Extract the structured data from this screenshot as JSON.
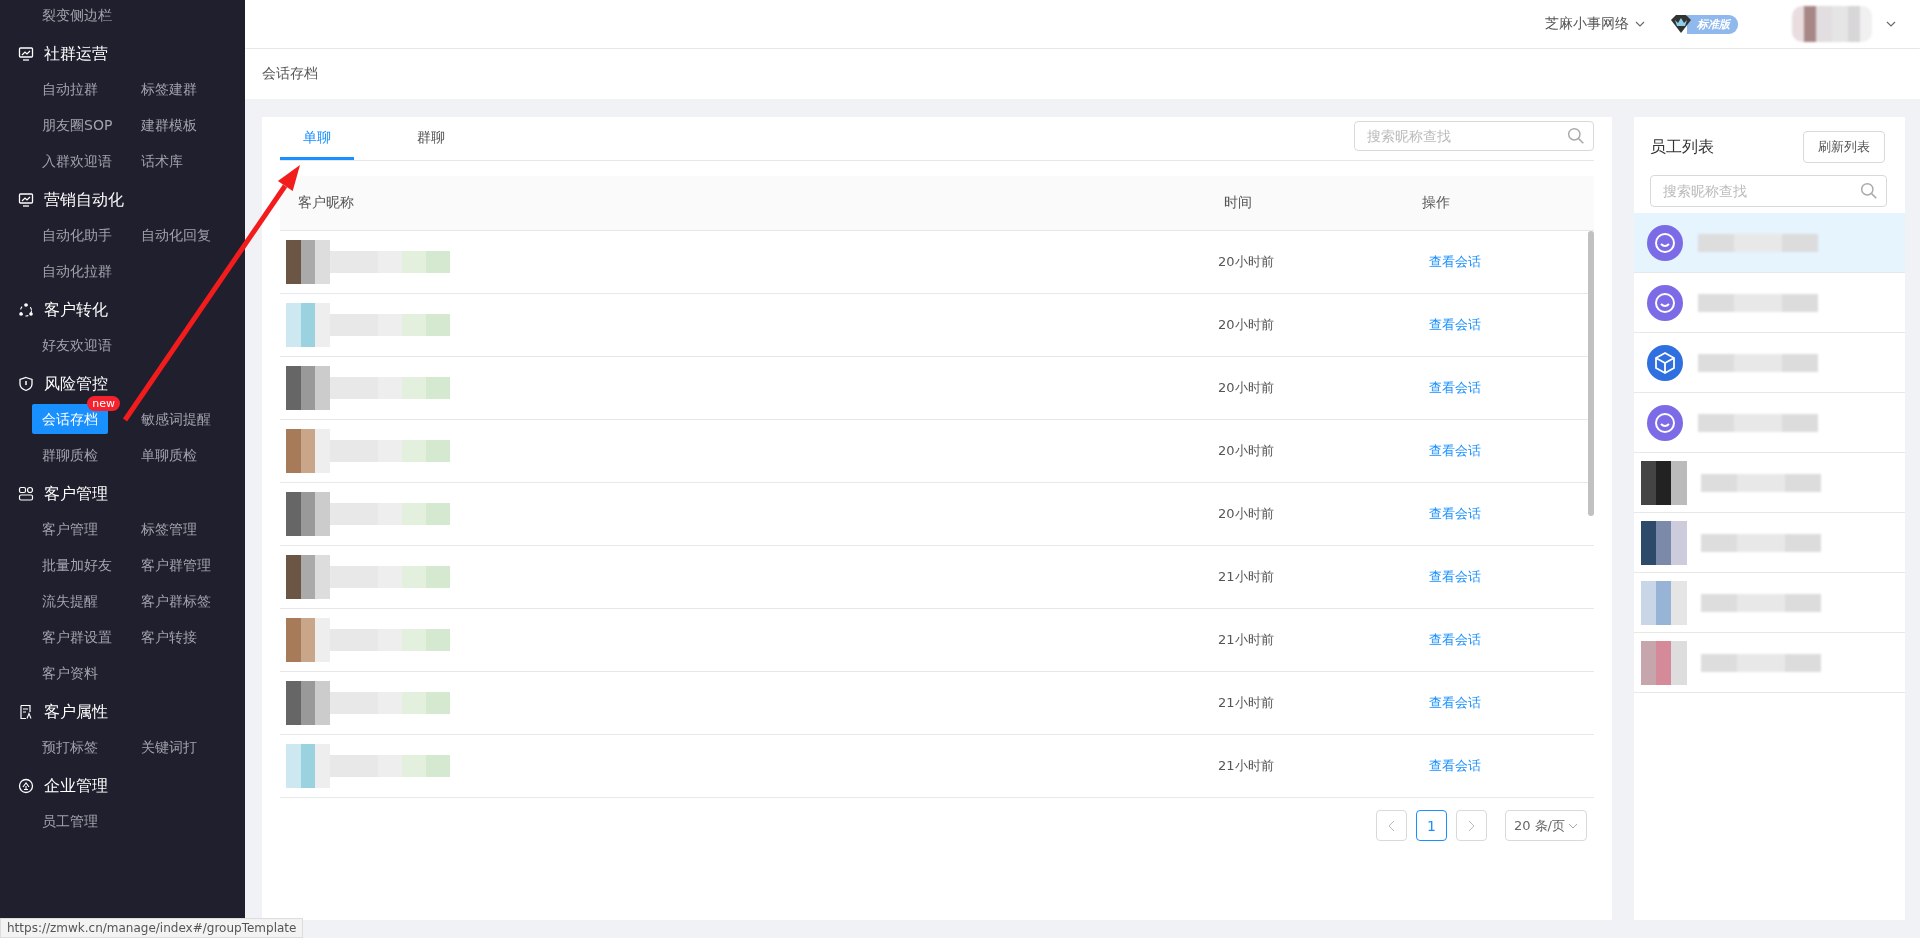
{
  "sidebar": {
    "top_items": [
      {
        "label": "裂变侧边栏",
        "selected": false
      }
    ],
    "groups": [
      {
        "title": "社群运营",
        "items": [
          {
            "label": "自动拉群",
            "selected": false
          },
          {
            "label": "标签建群",
            "selected": false
          },
          {
            "label": "朋友圈SOP",
            "selected": false
          },
          {
            "label": "建群模板",
            "selected": false
          },
          {
            "label": "入群欢迎语",
            "selected": false
          },
          {
            "label": "话术库",
            "selected": false
          }
        ]
      },
      {
        "title": "营销自动化",
        "items": [
          {
            "label": "自动化助手",
            "selected": false
          },
          {
            "label": "自动化回复",
            "selected": false
          },
          {
            "label": "自动化拉群",
            "selected": false
          }
        ]
      },
      {
        "title": "客户转化",
        "items": [
          {
            "label": "好友欢迎语",
            "selected": false
          }
        ]
      },
      {
        "title": "风险管控",
        "items": [
          {
            "label": "会话存档",
            "selected": true,
            "badge": "new"
          },
          {
            "label": "敏感词提醒",
            "selected": false
          },
          {
            "label": "群聊质检",
            "selected": false
          },
          {
            "label": "单聊质检",
            "selected": false
          }
        ]
      },
      {
        "title": "客户管理",
        "items": [
          {
            "label": "客户管理",
            "selected": false
          },
          {
            "label": "标签管理",
            "selected": false
          },
          {
            "label": "批量加好友",
            "selected": false
          },
          {
            "label": "客户群管理",
            "selected": false
          },
          {
            "label": "流失提醒",
            "selected": false
          },
          {
            "label": "客户群标签",
            "selected": false
          },
          {
            "label": "客户群设置",
            "selected": false
          },
          {
            "label": "客户转接",
            "selected": false
          },
          {
            "label": "客户资料",
            "selected": false
          }
        ]
      },
      {
        "title": "客户属性",
        "items": [
          {
            "label": "预打标签",
            "selected": false
          },
          {
            "label": "关键词打",
            "selected": false
          }
        ]
      },
      {
        "title": "企业管理",
        "items": [
          {
            "label": "员工管理",
            "selected": false
          }
        ]
      }
    ]
  },
  "topbar": {
    "company": "芝麻小事网络",
    "plan_badge": "标准版"
  },
  "breadcrumb": "会话存档",
  "chat_panel": {
    "tabs": [
      {
        "label": "单聊",
        "selected": true
      },
      {
        "label": "群聊",
        "selected": false
      }
    ],
    "search": {
      "placeholder": "搜索昵称查找"
    },
    "table": {
      "columns": [
        "客户昵称",
        "时间",
        "操作"
      ],
      "rows": [
        {
          "time": "20小时前",
          "action": "查看会话"
        },
        {
          "time": "20小时前",
          "action": "查看会话"
        },
        {
          "time": "20小时前",
          "action": "查看会话"
        },
        {
          "time": "20小时前",
          "action": "查看会话"
        },
        {
          "time": "20小时前",
          "action": "查看会话"
        },
        {
          "time": "21小时前",
          "action": "查看会话"
        },
        {
          "time": "21小时前",
          "action": "查看会话"
        },
        {
          "time": "21小时前",
          "action": "查看会话"
        },
        {
          "time": "21小时前",
          "action": "查看会话"
        }
      ]
    },
    "pagination": {
      "pages": [
        {
          "label": "1",
          "selected": true
        }
      ],
      "page_size": "20 条/页"
    }
  },
  "staff_panel": {
    "title": "员工列表",
    "refresh_button": "刷新列表",
    "search": {
      "placeholder": "搜索昵称查找"
    },
    "items": [
      {
        "kind": "smile",
        "selected": true
      },
      {
        "kind": "smile",
        "selected": false
      },
      {
        "kind": "cube",
        "selected": false
      },
      {
        "kind": "smile",
        "selected": false
      },
      {
        "kind": "photo",
        "selected": false
      },
      {
        "kind": "photo",
        "selected": false
      },
      {
        "kind": "photo",
        "selected": false
      },
      {
        "kind": "photo",
        "selected": false
      }
    ]
  },
  "status_url": "https://zmwk.cn/manage/index#/groupTemplate"
}
